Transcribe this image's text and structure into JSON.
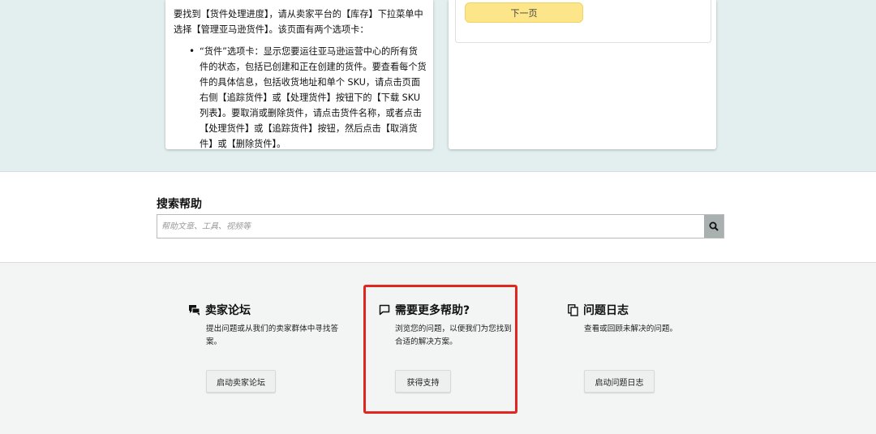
{
  "instructions": {
    "intro": "要找到【货件处理进度】，请从卖家平台的【库存】下拉菜单中选择【管理亚马逊货件】。该页面有两个选项卡：",
    "bullet": "“货件”选项卡：显示您要运往亚马逊运营中心的所有货件的状态，包括已创建和正在创建的货件。要查看每个货件的具体信息，包括收货地址和单个 SKU，请点击页面右侧【追踪货件】或【处理货件】按钮下的【下载 SKU 列表】。要取消或删除货件，请点击货件名称，或者点击【处理货件】或【追踪货件】按钮，然后点击【取消货件】或【删除货件】。"
  },
  "pager": {
    "next_label": "下一页"
  },
  "search": {
    "title": "搜索帮助",
    "placeholder": "帮助文章、工具、视频等"
  },
  "help_options": [
    {
      "title": "卖家论坛",
      "description": "提出问题或从我们的卖家群体中寻找答案。",
      "button": "启动卖家论坛",
      "icon": "forum-chat-icon"
    },
    {
      "title": "需要更多帮助?",
      "description": "浏览您的问题，以便我们为您找到合适的解决方案。",
      "button": "获得支持",
      "icon": "speech-bubble-icon"
    },
    {
      "title": "问题日志",
      "description": "查看或回顾未解决的问题。",
      "button": "启动问题日志",
      "icon": "copy-documents-icon"
    }
  ],
  "colors": {
    "top_band": "#e3efef",
    "next_button": "#fde68a",
    "highlight": "#e0271f",
    "search_button": "#a9b0b0"
  }
}
